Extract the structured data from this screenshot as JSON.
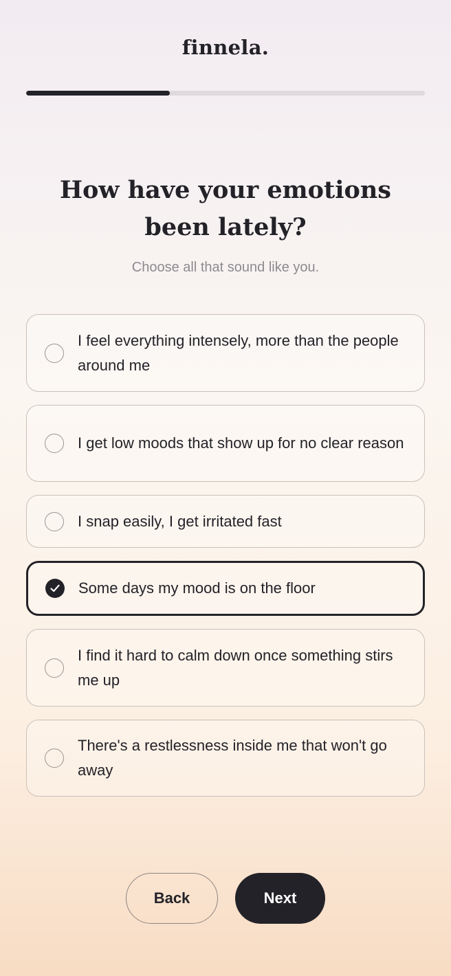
{
  "app": {
    "logo": "finnela."
  },
  "progress": {
    "fraction": 0.36
  },
  "question": {
    "title": "How have your emotions been lately?",
    "subtitle": "Choose all that sound like you."
  },
  "options": [
    {
      "label": "I feel everything intensely, more than the people around me",
      "selected": false
    },
    {
      "label": "I get low moods that show up for no clear reason",
      "selected": false
    },
    {
      "label": "I snap easily, I get irritated fast",
      "selected": false
    },
    {
      "label": "Some days my mood is on the floor",
      "selected": true
    },
    {
      "label": "I find it hard to calm down once something stirs me up",
      "selected": false
    },
    {
      "label": "There's a restlessness inside me that won't go away",
      "selected": false
    }
  ],
  "nav": {
    "back_label": "Back",
    "next_label": "Next"
  },
  "colors": {
    "primary": "#232228",
    "muted": "#8c8a8f",
    "border": "#c9c1ba"
  }
}
